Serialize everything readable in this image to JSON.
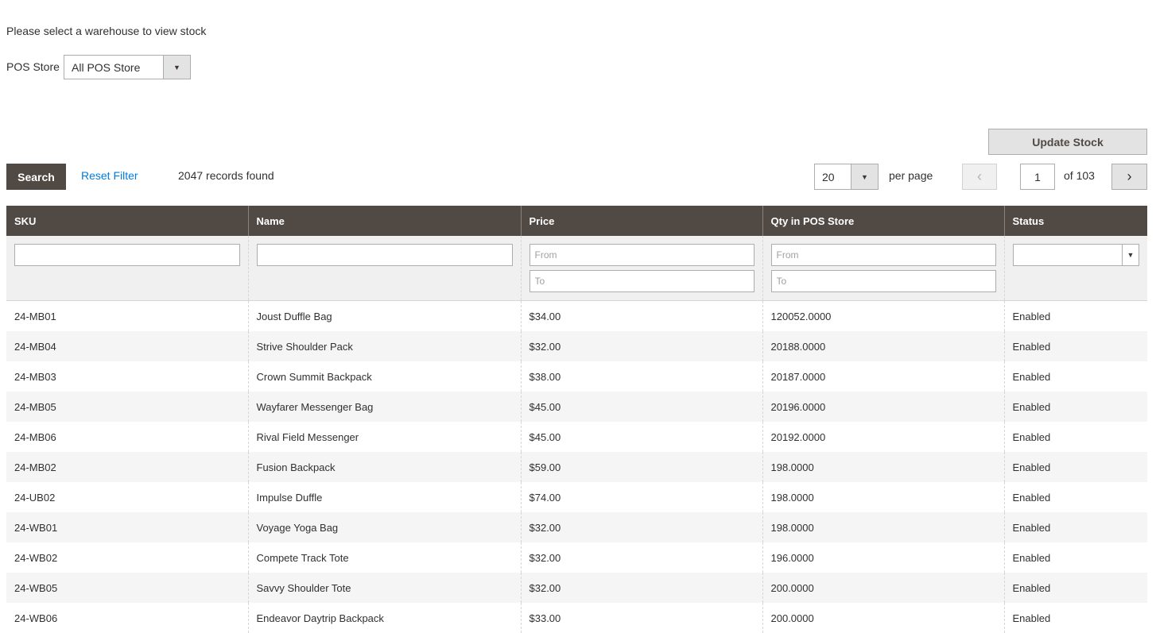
{
  "warehouse_message": "Please select a warehouse to view stock",
  "pos_store": {
    "label": "POS Store",
    "selected": "All POS Store"
  },
  "update_stock_label": "Update Stock",
  "toolbar": {
    "search_label": "Search",
    "reset_label": "Reset Filter",
    "records_found": "2047 records found",
    "per_page_value": "20",
    "per_page_label": "per page",
    "prev_icon": "‹",
    "next_icon": "›",
    "current_page": "1",
    "page_total": "of 103"
  },
  "columns": [
    "SKU",
    "Name",
    "Price",
    "Qty in POS Store",
    "Status"
  ],
  "filters": {
    "from_placeholder": "From",
    "to_placeholder": "To"
  },
  "rows": [
    {
      "sku": "24-MB01",
      "name": "Joust Duffle Bag",
      "price": "$34.00",
      "qty": "120052.0000",
      "status": "Enabled"
    },
    {
      "sku": "24-MB04",
      "name": "Strive Shoulder Pack",
      "price": "$32.00",
      "qty": "20188.0000",
      "status": "Enabled"
    },
    {
      "sku": "24-MB03",
      "name": "Crown Summit Backpack",
      "price": "$38.00",
      "qty": "20187.0000",
      "status": "Enabled"
    },
    {
      "sku": "24-MB05",
      "name": "Wayfarer Messenger Bag",
      "price": "$45.00",
      "qty": "20196.0000",
      "status": "Enabled"
    },
    {
      "sku": "24-MB06",
      "name": "Rival Field Messenger",
      "price": "$45.00",
      "qty": "20192.0000",
      "status": "Enabled"
    },
    {
      "sku": "24-MB02",
      "name": "Fusion Backpack",
      "price": "$59.00",
      "qty": "198.0000",
      "status": "Enabled"
    },
    {
      "sku": "24-UB02",
      "name": "Impulse Duffle",
      "price": "$74.00",
      "qty": "198.0000",
      "status": "Enabled"
    },
    {
      "sku": "24-WB01",
      "name": "Voyage Yoga Bag",
      "price": "$32.00",
      "qty": "198.0000",
      "status": "Enabled"
    },
    {
      "sku": "24-WB02",
      "name": "Compete Track Tote",
      "price": "$32.00",
      "qty": "196.0000",
      "status": "Enabled"
    },
    {
      "sku": "24-WB05",
      "name": "Savvy Shoulder Tote",
      "price": "$32.00",
      "qty": "200.0000",
      "status": "Enabled"
    },
    {
      "sku": "24-WB06",
      "name": "Endeavor Daytrip Backpack",
      "price": "$33.00",
      "qty": "200.0000",
      "status": "Enabled"
    }
  ]
}
